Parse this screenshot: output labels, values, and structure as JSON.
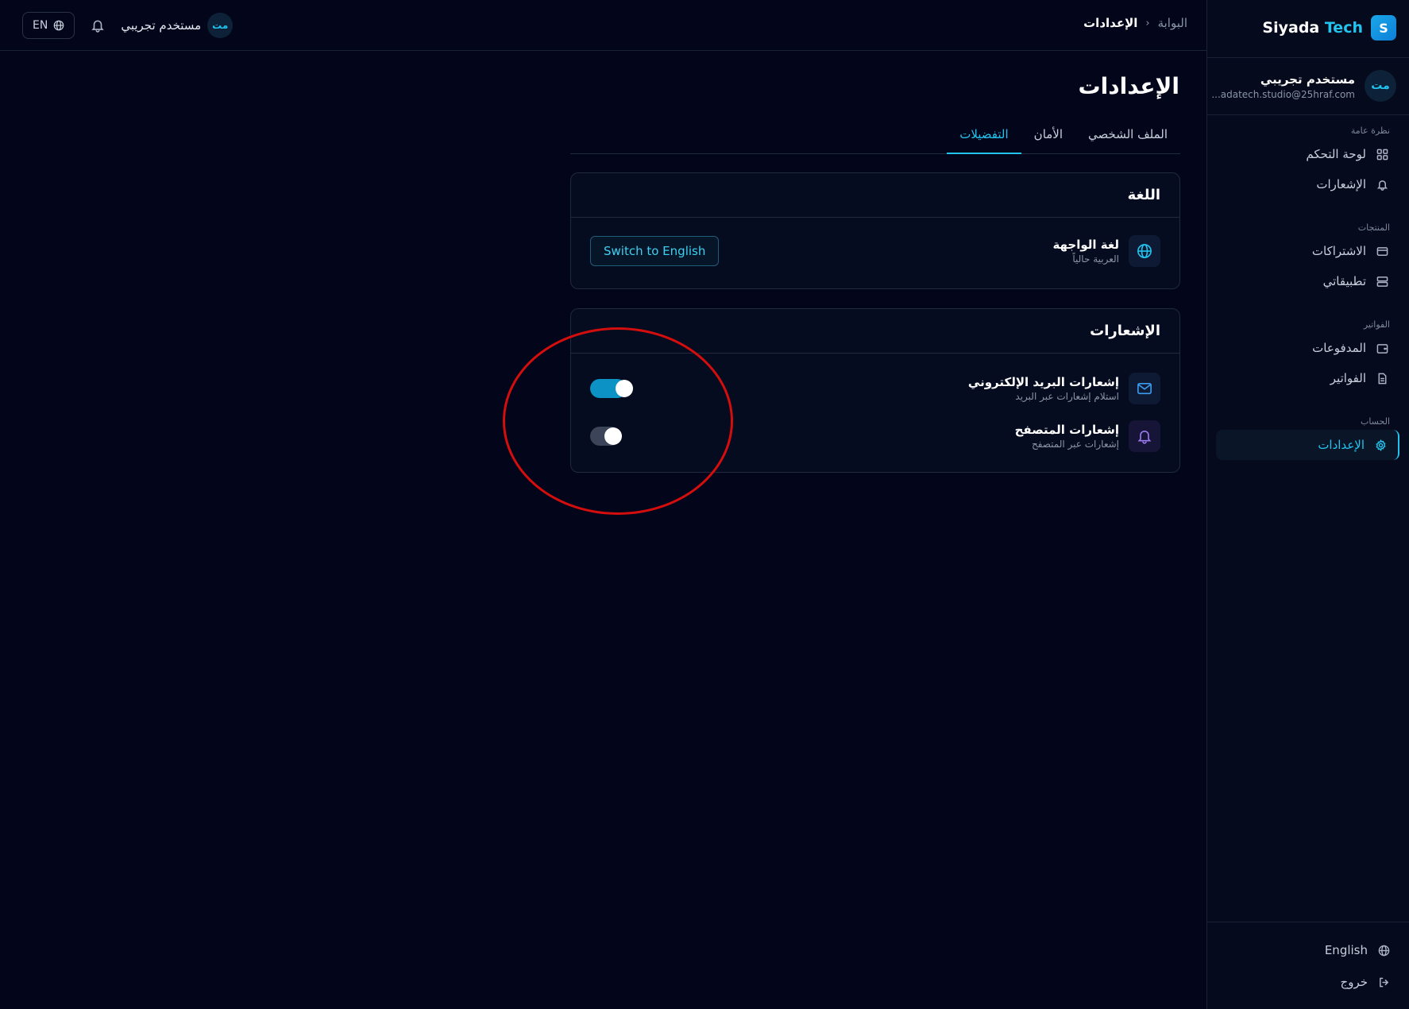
{
  "brand": {
    "logo_letter": "S",
    "name_main": "Siyada",
    "name_accent": "Tech",
    "accent_color": "#22c3ee"
  },
  "sidebar": {
    "user": {
      "initials": "مت",
      "name": "مستخدم تجريبي",
      "email": "...adatech.studio@25hraf.com"
    },
    "sections": [
      {
        "label": "نظرة عامة",
        "items": [
          {
            "label": "لوحة التحكم",
            "icon": "dashboard-icon"
          },
          {
            "label": "الإشعارات",
            "icon": "bell-icon"
          }
        ]
      },
      {
        "label": "المنتجات",
        "items": [
          {
            "label": "الاشتراكات",
            "icon": "card-icon"
          },
          {
            "label": "تطبيقاتي",
            "icon": "server-icon"
          }
        ]
      },
      {
        "label": "الفواتير",
        "items": [
          {
            "label": "المدفوعات",
            "icon": "wallet-icon"
          },
          {
            "label": "الفواتير",
            "icon": "document-icon"
          }
        ]
      },
      {
        "label": "الحساب",
        "items": [
          {
            "label": "الإعدادات",
            "icon": "gear-icon",
            "active": true
          }
        ]
      }
    ],
    "footer": {
      "language_label": "English",
      "logout_label": "خروج"
    }
  },
  "header": {
    "breadcrumb": {
      "root": "البوابة",
      "separator": "›",
      "current": "الإعدادات"
    },
    "lang_pill": "EN",
    "user": {
      "initials": "مت",
      "name": "مستخدم تجريبي"
    }
  },
  "main": {
    "title": "الإعدادات",
    "tabs": [
      {
        "label": "الملف الشخصي",
        "active": false
      },
      {
        "label": "الأمان",
        "active": false
      },
      {
        "label": "التفضيلات",
        "active": true
      }
    ],
    "language_card": {
      "title": "اللغة",
      "row": {
        "title": "لغة الواجهة",
        "subtitle": "العربية حالياً",
        "icon": "globe-icon",
        "button_label": "Switch to English"
      }
    },
    "notifications_card": {
      "title": "الإشعارات",
      "rows": [
        {
          "title": "إشعارات البريد الإلكتروني",
          "subtitle": "استلام إشعارات عبر البريد",
          "icon": "mail-icon",
          "enabled": true
        },
        {
          "title": "إشعارات المتصفح",
          "subtitle": "إشعارات عبر المتصفح",
          "icon": "bell-icon",
          "enabled": false
        }
      ]
    }
  },
  "annotation": {
    "shape": "ellipse",
    "color": "#d40d0d"
  }
}
